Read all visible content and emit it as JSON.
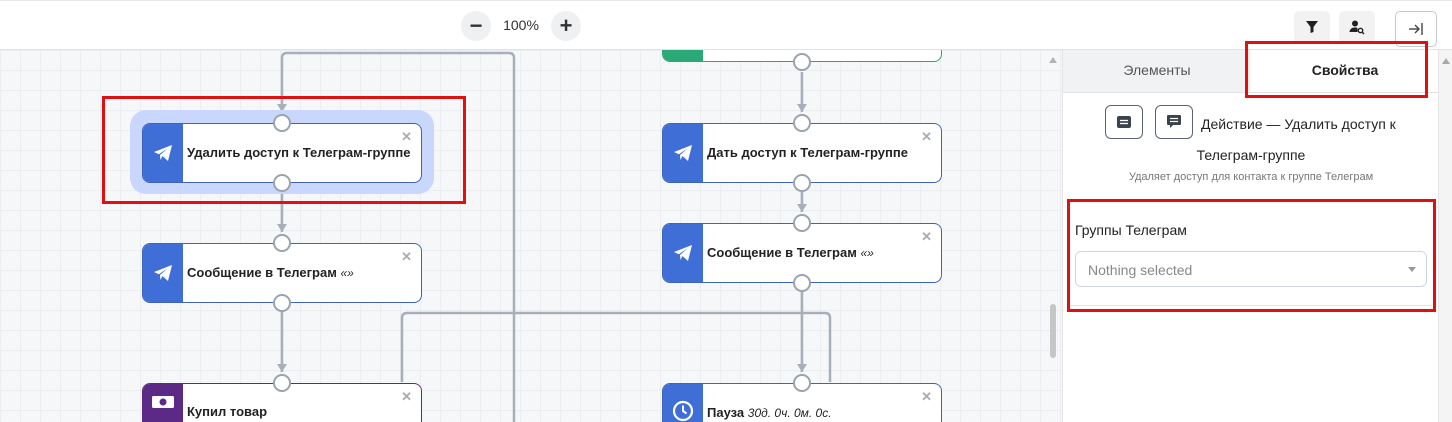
{
  "toolbar": {
    "zoom_out_label": "−",
    "zoom_level": "100%",
    "zoom_in_label": "+",
    "filter_icon": "filter-icon",
    "user_search_icon": "user-search-icon",
    "collapse_icon": "arrow-to-right-icon"
  },
  "canvas": {
    "nodes": [
      {
        "title": "Удалить доступ к Телеграм-группе",
        "subtitle": "",
        "icon": "telegram-icon"
      },
      {
        "title": "Сообщение в Телеграм",
        "subtitle": "«»",
        "icon": "telegram-icon"
      },
      {
        "title": "Купил товар",
        "subtitle": "",
        "icon": "money-icon"
      },
      {
        "title": "Дать доступ к Телеграм-группе",
        "subtitle": "",
        "icon": "telegram-icon"
      },
      {
        "title": "Сообщение в Телеграм",
        "subtitle": "«»",
        "icon": "telegram-icon"
      },
      {
        "title": "Пауза",
        "subtitle": "30д. 0ч. 0м. 0с.",
        "icon": "clock-icon"
      }
    ],
    "close_glyph": "✕"
  },
  "panel": {
    "tabs": [
      {
        "label": "Элементы",
        "active": false
      },
      {
        "label": "Свойства",
        "active": true
      }
    ],
    "action_title_line1": "Действие — Удалить доступ к",
    "action_title_line2": "Телеграм-группе",
    "action_description": "Удаляет доступ для контакта к группе Телеграм",
    "field_label": "Группы Телеграм",
    "select_placeholder": "Nothing selected"
  },
  "colors": {
    "telegram_blue": "#3f6fd6",
    "purchase_purple": "#5b2a86",
    "trigger_green": "#2aa876",
    "highlight_red": "#e01010"
  }
}
